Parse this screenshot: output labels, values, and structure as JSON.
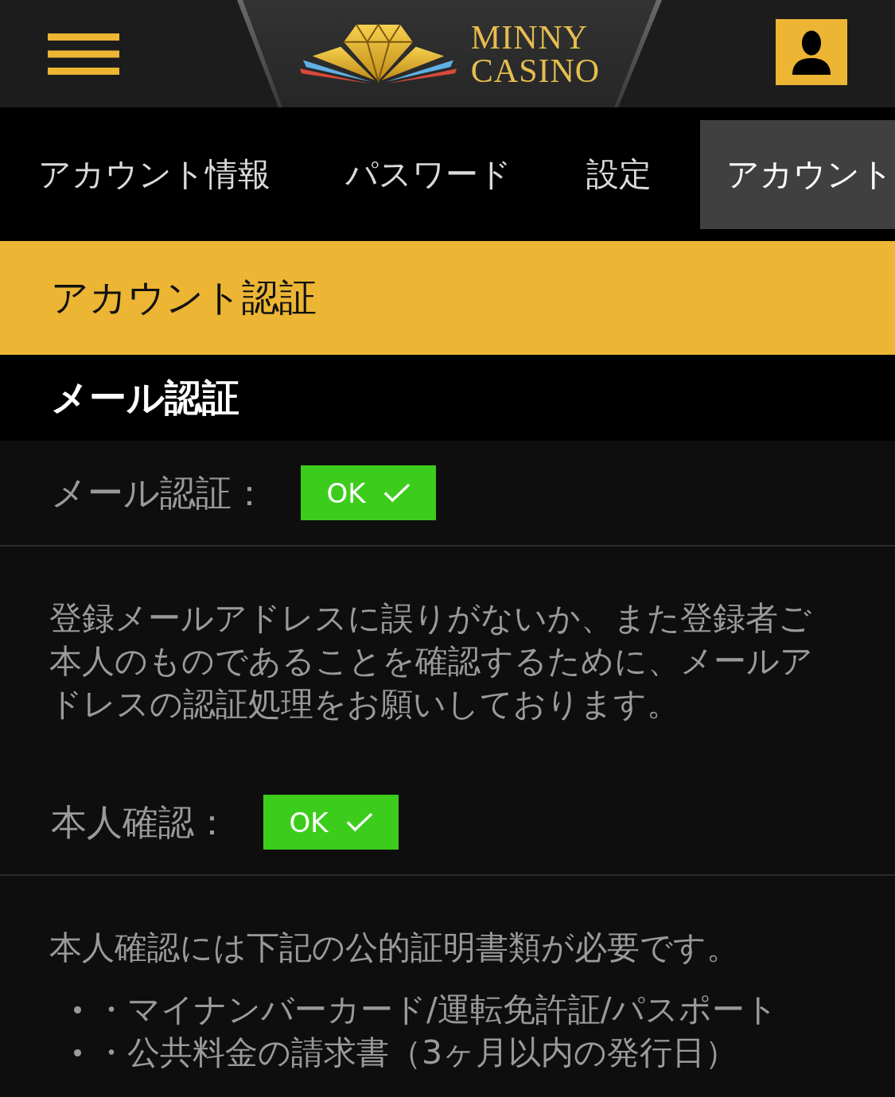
{
  "header": {
    "logo_lines": [
      "MINNY",
      "CASINO"
    ]
  },
  "tabs": [
    {
      "label": "アカウント情報",
      "selected": false
    },
    {
      "label": "パスワード",
      "selected": false
    },
    {
      "label": "設定",
      "selected": false
    },
    {
      "label": "アカウント",
      "selected": true
    }
  ],
  "page_title": "アカウント認証",
  "section_title": "メール認証",
  "checks": [
    {
      "label": "メール認証：",
      "badge": "OK",
      "verified": true,
      "text": "登録メールアドレスに誤りがないか、また登録者ご本人のものであることを確認するために、メールアドレスの認証処理をお願いしております。"
    },
    {
      "label": "本人確認：",
      "badge": "OK",
      "verified": true,
      "text": "本人確認には下記の公的証明書類が必要です。",
      "list": [
        "・マイナンバーカード/運転免許証/パスポート",
        "・公共料金の請求書（3ヶ月以内の発行日）"
      ]
    }
  ]
}
